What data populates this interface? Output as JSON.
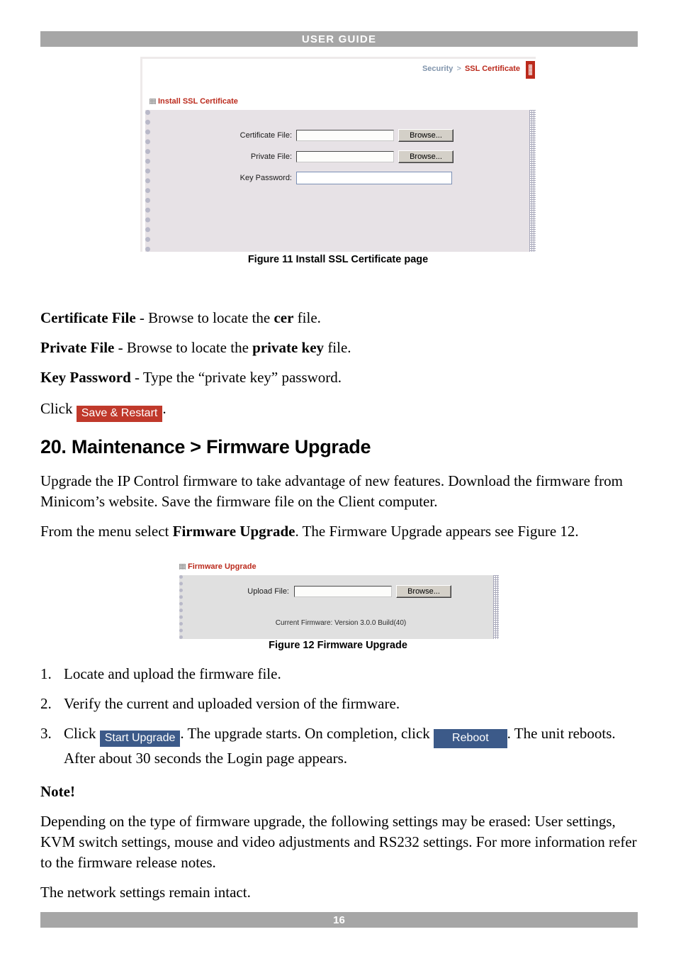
{
  "header": {
    "title": "USER GUIDE"
  },
  "footer": {
    "page_number": "16"
  },
  "figure11": {
    "breadcrumb": {
      "parent": "Security",
      "separator": ">",
      "current": "SSL Certificate"
    },
    "section_title": "Install SSL Certificate",
    "fields": [
      {
        "label": "Certificate File:",
        "value": "",
        "button": "Browse..."
      },
      {
        "label": "Private File:",
        "value": "",
        "button": "Browse..."
      },
      {
        "label": "Key Password:",
        "value": ""
      }
    ],
    "caption": "Figure 11 Install SSL Certificate page"
  },
  "descriptions": [
    {
      "term": "Certificate File",
      "dash": " - ",
      "text_before": "Browse to locate the ",
      "emphasis": "cer",
      "text_after": " file."
    },
    {
      "term": "Private File",
      "dash": " - ",
      "text_before": "Browse to locate the ",
      "emphasis": "private key",
      "text_after": " file."
    },
    {
      "term": "Key Password",
      "dash": " - ",
      "text_before": "Type the “private key” password.",
      "emphasis": "",
      "text_after": ""
    }
  ],
  "click_save": {
    "prefix": "Click ",
    "button_label": "Save & Restart",
    "suffix": "."
  },
  "section": {
    "heading": "20. Maintenance > Firmware Upgrade",
    "paragraph1": "Upgrade the IP Control firmware to take advantage of new features. Download the firmware from Minicom’s website. Save the firmware file on the Client computer.",
    "paragraph2_before": "From the menu select ",
    "paragraph2_bold": "Firmware Upgrade",
    "paragraph2_after": ". The Firmware Upgrade appears see Figure 12."
  },
  "figure12": {
    "section_title": "Firmware Upgrade",
    "field": {
      "label": "Upload File:",
      "value": "",
      "button": "Browse..."
    },
    "current_firmware": "Current Firmware: Version 3.0.0 Build(40)",
    "caption": "Figure 12 Firmware Upgrade"
  },
  "steps": [
    {
      "num": "1.",
      "text": "Locate and upload the firmware file."
    },
    {
      "num": "2.",
      "text": "Verify the current and uploaded version of the firmware."
    },
    {
      "num": "3.",
      "part1": "Click ",
      "button1": "Start Upgrade",
      "part2": ". The upgrade starts. On completion, click ",
      "button2": "Reboot",
      "part3": ". The unit reboots. After about 30 seconds the Login page appears."
    }
  ],
  "note": {
    "title": "Note!",
    "body": "Depending on the type of firmware upgrade, the following settings may be erased: User settings, KVM switch settings, mouse and video adjustments and RS232 settings. For more information refer to the firmware release notes.",
    "closing": "The network settings remain intact."
  },
  "colors": {
    "header_bar": "#a6a6a6",
    "accent_red": "#bb2a1c",
    "button_red": "#c0392b",
    "button_blue": "#3c5a89",
    "breadcrumb_parent": "#8094ac",
    "panel_bg": "#e7e2e6"
  }
}
